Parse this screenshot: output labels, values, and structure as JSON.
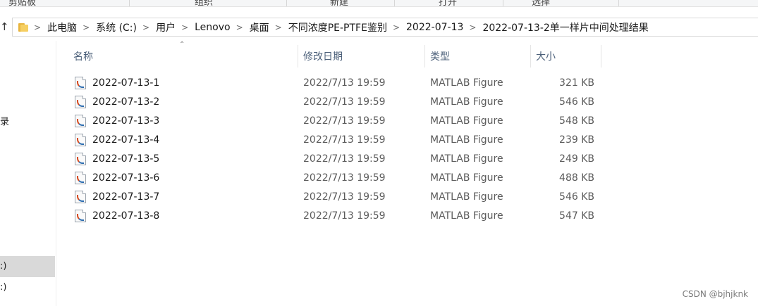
{
  "ribbon": {
    "groups": [
      "剪贴板",
      "组织",
      "新建",
      "打开",
      "选择"
    ]
  },
  "address_bar": {
    "crumbs": [
      "此电脑",
      "系统 (C:)",
      "用户",
      "Lenovo",
      "桌面",
      "不同浓度PE-PTFE鉴别",
      "2022-07-13",
      "2022-07-13-2单一样片中间处理结果"
    ]
  },
  "nav_pane": {
    "fragments": [
      "录",
      ":)",
      ":)"
    ]
  },
  "columns": {
    "name": "名称",
    "date": "修改日期",
    "type": "类型",
    "size": "大小"
  },
  "files": [
    {
      "name": "2022-07-13-1",
      "date": "2022/7/13 19:59",
      "type": "MATLAB Figure",
      "size": "321 KB"
    },
    {
      "name": "2022-07-13-2",
      "date": "2022/7/13 19:59",
      "type": "MATLAB Figure",
      "size": "546 KB"
    },
    {
      "name": "2022-07-13-3",
      "date": "2022/7/13 19:59",
      "type": "MATLAB Figure",
      "size": "548 KB"
    },
    {
      "name": "2022-07-13-4",
      "date": "2022/7/13 19:59",
      "type": "MATLAB Figure",
      "size": "239 KB"
    },
    {
      "name": "2022-07-13-5",
      "date": "2022/7/13 19:59",
      "type": "MATLAB Figure",
      "size": "249 KB"
    },
    {
      "name": "2022-07-13-6",
      "date": "2022/7/13 19:59",
      "type": "MATLAB Figure",
      "size": "488 KB"
    },
    {
      "name": "2022-07-13-7",
      "date": "2022/7/13 19:59",
      "type": "MATLAB Figure",
      "size": "546 KB"
    },
    {
      "name": "2022-07-13-8",
      "date": "2022/7/13 19:59",
      "type": "MATLAB Figure",
      "size": "547 KB"
    }
  ],
  "watermark": "CSDN @bjhjknk",
  "colors": {
    "header_text": "#4c607a",
    "selection": "#d9d9d9",
    "folder": "#f6cf62"
  }
}
